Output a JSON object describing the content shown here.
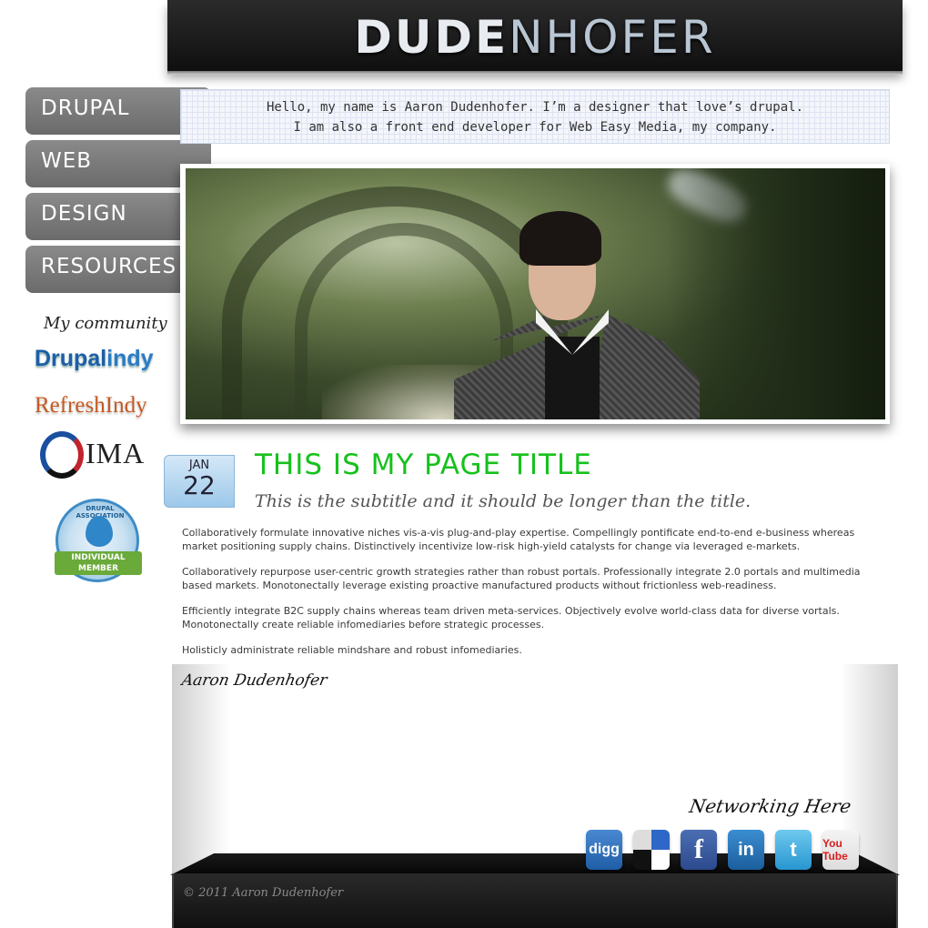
{
  "header": {
    "logo_bold": "DUDE",
    "logo_thin": "NHOFER"
  },
  "nav": {
    "items": [
      {
        "label": "DRUPAL"
      },
      {
        "label": "WEB"
      },
      {
        "label": "DESIGN"
      },
      {
        "label": "RESOURCES"
      }
    ]
  },
  "intro": {
    "line1": "Hello, my name is Aaron Dudenhofer. I’m a designer that love’s drupal.",
    "line2": "I am also a front end developer for Web Easy Media, my company."
  },
  "sidebar": {
    "community_title": "My community",
    "drupalindy_a": "Drupal",
    "drupalindy_b": "indy",
    "refreshindy": "RefreshIndy",
    "ima": "IMA",
    "assoc_arc": "DRUPAL ASSOCIATION",
    "assoc_ribbon_1": "INDIVIDUAL",
    "assoc_ribbon_2": "MEMBER"
  },
  "post": {
    "month": "JAN",
    "day": "22",
    "title": "THIS IS MY PAGE TITLE",
    "subtitle": "This is the subtitle and it should be longer than the title.",
    "paragraphs": [
      "Collaboratively formulate innovative niches vis-a-vis plug-and-play expertise. Compellingly pontificate end-to-end e-business whereas market positioning supply chains. Distinctively incentivize low-risk high-yield catalysts for change via leveraged e-markets.",
      "Collaboratively repurpose user-centric growth strategies rather than robust portals. Professionally integrate 2.0 portals and multimedia based markets. Monotonectally leverage existing proactive manufactured products without frictionless web-readiness.",
      "Efficiently integrate B2C supply chains whereas team driven meta-services. Objectively evolve world-class data for diverse vortals. Monotonectally create reliable infomediaries before strategic processes.",
      "Holisticly administrate reliable mindshare and robust infomediaries."
    ],
    "signature": "Aaron Dudenhofer"
  },
  "networking": {
    "title": "Networking Here",
    "icons": [
      {
        "name": "digg-icon",
        "glyph": "digg"
      },
      {
        "name": "delicious-icon",
        "glyph": ""
      },
      {
        "name": "facebook-icon",
        "glyph": "f"
      },
      {
        "name": "linkedin-icon",
        "glyph": "in"
      },
      {
        "name": "twitter-icon",
        "glyph": "t"
      },
      {
        "name": "youtube-icon",
        "glyph": "You Tube"
      }
    ]
  },
  "footer": {
    "copyright": "© 2011 Aaron Dudenhofer"
  }
}
